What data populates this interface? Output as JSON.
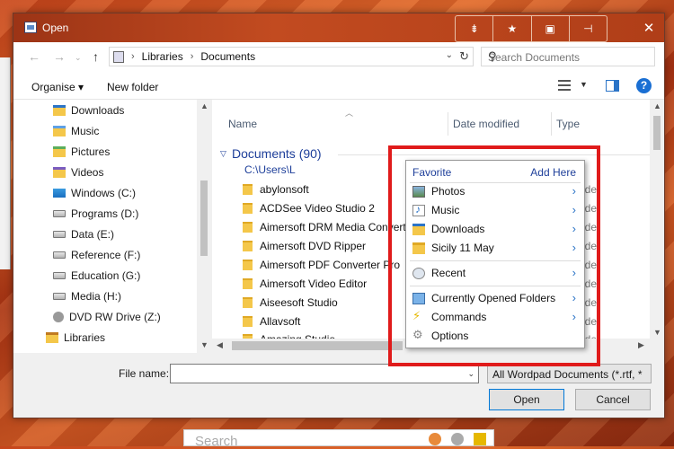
{
  "window": {
    "title": "Open"
  },
  "titlebar_buttons": [
    {
      "name": "pin-icon",
      "glyph": "⇟"
    },
    {
      "name": "star-icon",
      "glyph": "★"
    },
    {
      "name": "folder-settings-icon",
      "glyph": "▣"
    },
    {
      "name": "plug-icon",
      "glyph": "⊣"
    }
  ],
  "close_glyph": "✕",
  "address": {
    "crumbs": [
      "Libraries",
      "Documents"
    ],
    "search_placeholder": "Search Documents"
  },
  "toolbar": {
    "organise": "Organise ▾",
    "new_folder": "New folder",
    "help": "?"
  },
  "nav": {
    "items": [
      {
        "label": "Downloads",
        "icon": "dl"
      },
      {
        "label": "Music",
        "icon": "music"
      },
      {
        "label": "Pictures",
        "icon": "pictures"
      },
      {
        "label": "Videos",
        "icon": "videos"
      },
      {
        "label": "Windows (C:)",
        "icon": "win"
      },
      {
        "label": "Programs (D:)",
        "icon": "drive"
      },
      {
        "label": "Data (E:)",
        "icon": "drive"
      },
      {
        "label": "Reference (F:)",
        "icon": "drive"
      },
      {
        "label": "Education (G:)",
        "icon": "drive"
      },
      {
        "label": "Media (H:)",
        "icon": "drive"
      },
      {
        "label": "DVD RW Drive (Z:)",
        "icon": "dvd"
      },
      {
        "label": "Libraries",
        "icon": "lib"
      }
    ]
  },
  "files": {
    "columns": {
      "name": "Name",
      "date": "Date modified",
      "type": "Type"
    },
    "group": {
      "title": "Documents (90)",
      "path": "C:\\Users\\L"
    },
    "rows": [
      {
        "name": "abylonsoft",
        "type": "lder"
      },
      {
        "name": "ACDSee Video Studio 2",
        "type": "lder"
      },
      {
        "name": "Aimersoft DRM Media Converter",
        "type": "lder"
      },
      {
        "name": "Aimersoft DVD Ripper",
        "type": "lder"
      },
      {
        "name": "Aimersoft PDF Converter Pro",
        "type": "lder"
      },
      {
        "name": "Aimersoft Video Editor",
        "type": "lder"
      },
      {
        "name": "Aiseesoft Studio",
        "type": "lder"
      },
      {
        "name": "Allavsoft",
        "type": "lder"
      },
      {
        "name": "Amazing Studio",
        "type": "lder"
      }
    ]
  },
  "bottom": {
    "file_name_label": "File name:",
    "file_name_value": "",
    "file_type": "All Wordpad Documents (*.rtf, *",
    "open": "Open",
    "cancel": "Cancel"
  },
  "menu": {
    "favorite": "Favorite",
    "add_here": "Add Here",
    "favorites": [
      {
        "label": "Photos",
        "icon": "photos"
      },
      {
        "label": "Music",
        "icon": "music"
      },
      {
        "label": "Downloads",
        "icon": "dl"
      },
      {
        "label": "Sicily 11 May",
        "icon": "folder"
      }
    ],
    "recent": "Recent",
    "opened": "Currently Opened Folders",
    "commands": "Commands",
    "options": "Options"
  },
  "background": {
    "search_placeholder": "Search"
  }
}
